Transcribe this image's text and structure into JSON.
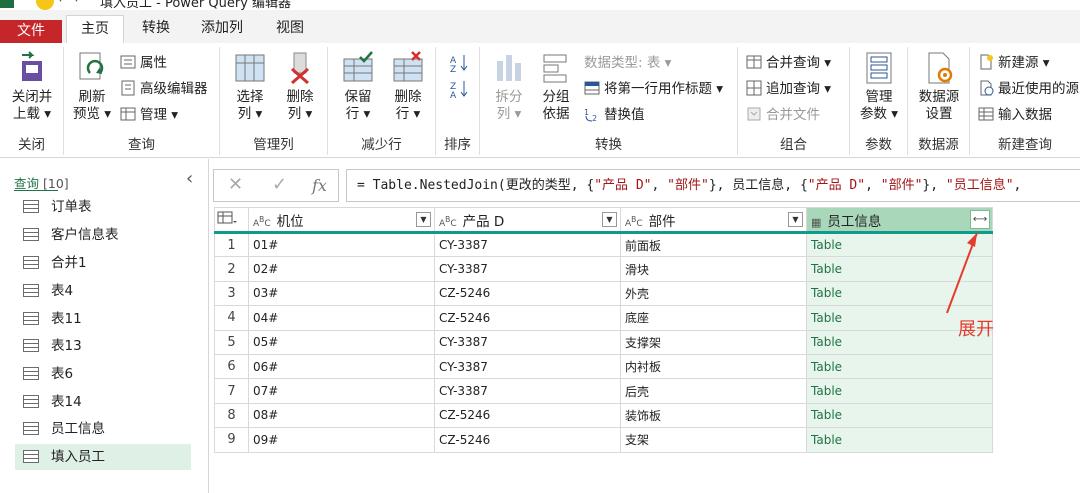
{
  "window": {
    "title": "填入员工 - Power Query 编辑器"
  },
  "tabs": [
    {
      "label": "文件"
    },
    {
      "label": "主页"
    },
    {
      "label": "转换"
    },
    {
      "label": "添加列"
    },
    {
      "label": "视图"
    }
  ],
  "ribbon": {
    "close": {
      "btn_line1": "关闭并",
      "btn_line2": "上载",
      "group": "关闭"
    },
    "query": {
      "refresh_line1": "刷新",
      "refresh_line2": "预览",
      "properties": "属性",
      "advanced_editor": "高级编辑器",
      "manage": "管理",
      "group": "查询"
    },
    "manage_cols": {
      "choose_line1": "选择",
      "choose_line2": "列",
      "remove_line1": "删除",
      "remove_line2": "列",
      "group": "管理列"
    },
    "reduce_rows": {
      "keep_line1": "保留",
      "keep_line2": "行",
      "remove_line1": "删除",
      "remove_line2": "行",
      "group": "减少行"
    },
    "sort": {
      "group": "排序"
    },
    "transform": {
      "split_line1": "拆分",
      "split_line2": "列",
      "groupby_line1": "分组",
      "groupby_line2": "依据",
      "datatype": "数据类型: 表",
      "first_row_header": "将第一行用作标题",
      "replace_values": "替换值",
      "group": "转换"
    },
    "combine": {
      "merge_queries": "合并查询",
      "append_queries": "追加查询",
      "combine_files": "合并文件",
      "group": "组合"
    },
    "params": {
      "manage_line1": "管理",
      "manage_line2": "参数",
      "group": "参数"
    },
    "datasource": {
      "settings_line1": "数据源",
      "settings_line2": "设置",
      "group": "数据源"
    },
    "newquery": {
      "new_source": "新建源",
      "recent_sources": "最近使用的源",
      "enter_data": "输入数据",
      "group": "新建查询"
    }
  },
  "queries": {
    "header": "查询",
    "count": "[10]",
    "items": [
      "订单表",
      "客户信息表",
      "合并1",
      "表4",
      "表11",
      "表13",
      "表6",
      "表14",
      "员工信息",
      "填入员工"
    ],
    "selected": "填入员工"
  },
  "formula": {
    "cancel": "✕",
    "confirm": "✓",
    "fx": "fx",
    "part1": "= Table.NestedJoin(更改的类型, {",
    "s1": "\"产品 D\"",
    "part2": ", ",
    "s2": "\"部件\"",
    "part3": "}, 员工信息, {",
    "s3": "\"产品 D\"",
    "part4": ", ",
    "s4": "\"部件\"",
    "part5": "}, ",
    "s5": "\"员工信息\"",
    "part6": ","
  },
  "table": {
    "columns": [
      "机位",
      "产品 D",
      "部件",
      "员工信息"
    ],
    "rows": [
      [
        "1",
        "01#",
        "CY-3387",
        "前面板",
        "Table"
      ],
      [
        "2",
        "02#",
        "CY-3387",
        "滑块",
        "Table"
      ],
      [
        "3",
        "03#",
        "CZ-5246",
        "外壳",
        "Table"
      ],
      [
        "4",
        "04#",
        "CZ-5246",
        "底座",
        "Table"
      ],
      [
        "5",
        "05#",
        "CY-3387",
        "支撑架",
        "Table"
      ],
      [
        "6",
        "06#",
        "CY-3387",
        "内衬板",
        "Table"
      ],
      [
        "7",
        "07#",
        "CY-3387",
        "后壳",
        "Table"
      ],
      [
        "8",
        "08#",
        "CZ-5246",
        "装饰板",
        "Table"
      ],
      [
        "9",
        "09#",
        "CZ-5246",
        "支架",
        "Table"
      ]
    ]
  },
  "annotation": "展开",
  "colors": {
    "accent": "#217346",
    "file_tab": "#c5262a",
    "annotation": "#e53a2d",
    "table_cell_bg": "#e8f5ec"
  }
}
